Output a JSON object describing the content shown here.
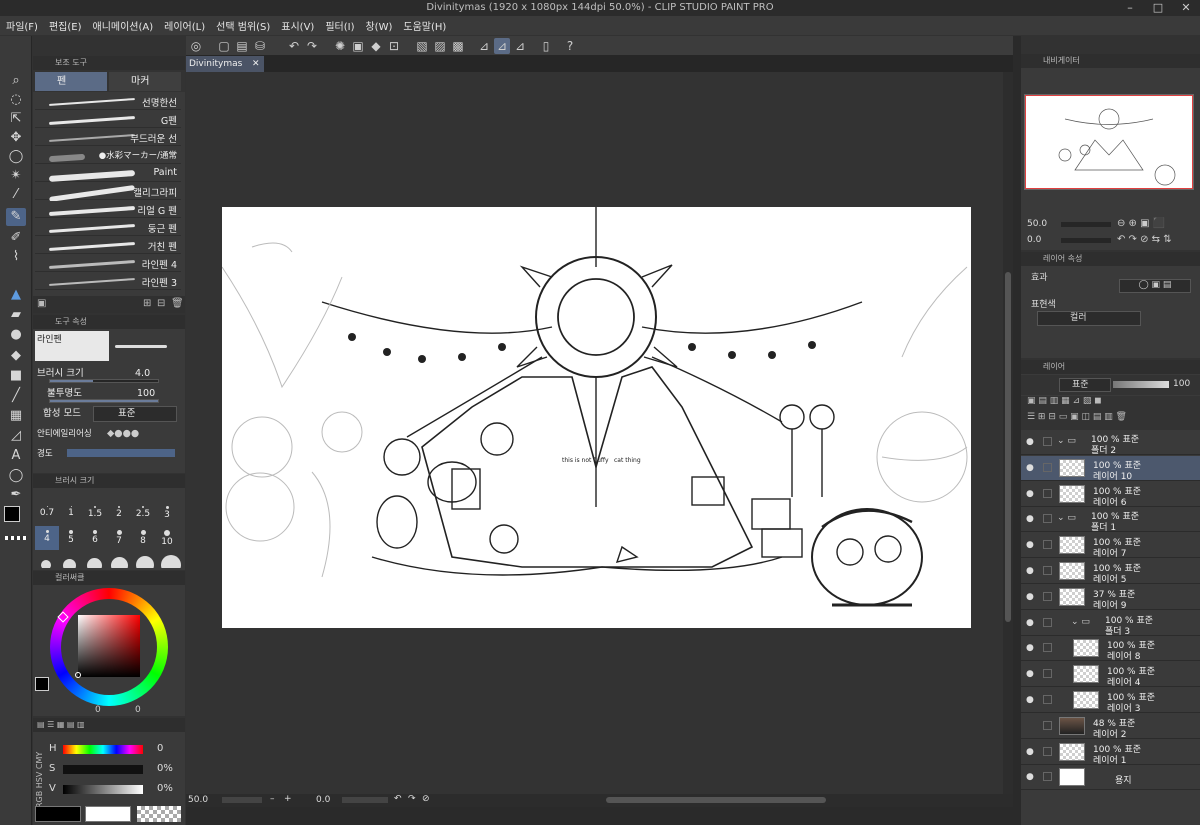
{
  "window": {
    "title": "Divinitymas (1920 x 1080px 144dpi 50.0%) - CLIP STUDIO PAINT PRO"
  },
  "menu": [
    "파일(F)",
    "편집(E)",
    "애니메이션(A)",
    "레이어(L)",
    "선택 범위(S)",
    "표시(V)",
    "필터(I)",
    "창(W)",
    "도움말(H)"
  ],
  "document": {
    "tab": "Divinitymas"
  },
  "subtool": {
    "header": "보조 도구",
    "tabs": [
      "펜",
      "마커"
    ],
    "brushes": [
      "선명한선",
      "G펜",
      "부드러운 선",
      "●水彩マーカー/通常",
      "Paint",
      "캘리그라피",
      "리얼 G 펜",
      "둥근 펜",
      "거친 펜",
      "라인펜 4",
      "라인펜 3"
    ]
  },
  "toolprop": {
    "header": "도구 속성",
    "brush_name": "라인펜",
    "size_label": "브러시 크기",
    "size_value": "4.0",
    "opacity_label": "불투명도",
    "opacity_value": "100",
    "blend_label": "합성 모드",
    "blend_value": "표준",
    "aa_label": "안티에일리어싱",
    "cut_label": "경도"
  },
  "brushsize": {
    "header": "브러시 크기",
    "sizes": [
      "0.7",
      "1",
      "1.5",
      "2",
      "2.5",
      "3",
      "4",
      "5",
      "6",
      "7",
      "8",
      "10"
    ]
  },
  "colorwheel": {
    "header": "컬러써클",
    "val_a": "0",
    "val_b": "0"
  },
  "colorslider": {
    "tabs": [
      "RGB",
      "HSV",
      "CMY"
    ],
    "h_label": "H",
    "h_value": "0",
    "s_label": "S",
    "s_value": "0%",
    "v_label": "V",
    "v_value": "0%"
  },
  "status": {
    "zoom": "50.0",
    "angle": "0.0"
  },
  "navigator": {
    "header": "내비게이터",
    "zoom": "50.0",
    "angle": "0.0"
  },
  "layerprop": {
    "header": "레이어 속성",
    "effect_label": "효과",
    "express_label": "표현색",
    "express_value": "컬러"
  },
  "layers": {
    "header": "레이어",
    "blend": "표준",
    "opacity": "100",
    "items": [
      {
        "l1": "100 % 표준",
        "l2": "폴더 2",
        "kind": "folder",
        "indent": 0
      },
      {
        "l1": "100 % 표준",
        "l2": "레이어 10",
        "kind": "layer",
        "indent": 0,
        "selected": true
      },
      {
        "l1": "100 % 표준",
        "l2": "레이어 6",
        "kind": "layer",
        "indent": 0
      },
      {
        "l1": "100 % 표준",
        "l2": "폴더 1",
        "kind": "folder",
        "indent": 0
      },
      {
        "l1": "100 % 표준",
        "l2": "레이어 7",
        "kind": "layer",
        "indent": 0
      },
      {
        "l1": "100 % 표준",
        "l2": "레이어 5",
        "kind": "layer",
        "indent": 0
      },
      {
        "l1": "37 % 표준",
        "l2": "레이어 9",
        "kind": "layer",
        "indent": 0
      },
      {
        "l1": "100 % 표준",
        "l2": "폴더 3",
        "kind": "folder",
        "indent": 1
      },
      {
        "l1": "100 % 표준",
        "l2": "레이어 8",
        "kind": "layer",
        "indent": 1
      },
      {
        "l1": "100 % 표준",
        "l2": "레이어 4",
        "kind": "layer",
        "indent": 1
      },
      {
        "l1": "100 % 표준",
        "l2": "레이어 3",
        "kind": "layer",
        "indent": 1
      },
      {
        "l1": "48 % 표준",
        "l2": "레이어 2",
        "kind": "photo",
        "indent": 0
      },
      {
        "l1": "100 % 표준",
        "l2": "레이어 1",
        "kind": "layer",
        "indent": 0
      },
      {
        "l1": "",
        "l2": "용지",
        "kind": "paper",
        "indent": 0
      }
    ]
  },
  "artwork": {
    "small_text_left": "this is not fluffy",
    "small_text_right": "cat thing"
  },
  "colors": {
    "accent": "#5b6b86",
    "selected_layer": "#4c586d",
    "panel": "#3a3a3a",
    "background": "#323232"
  }
}
